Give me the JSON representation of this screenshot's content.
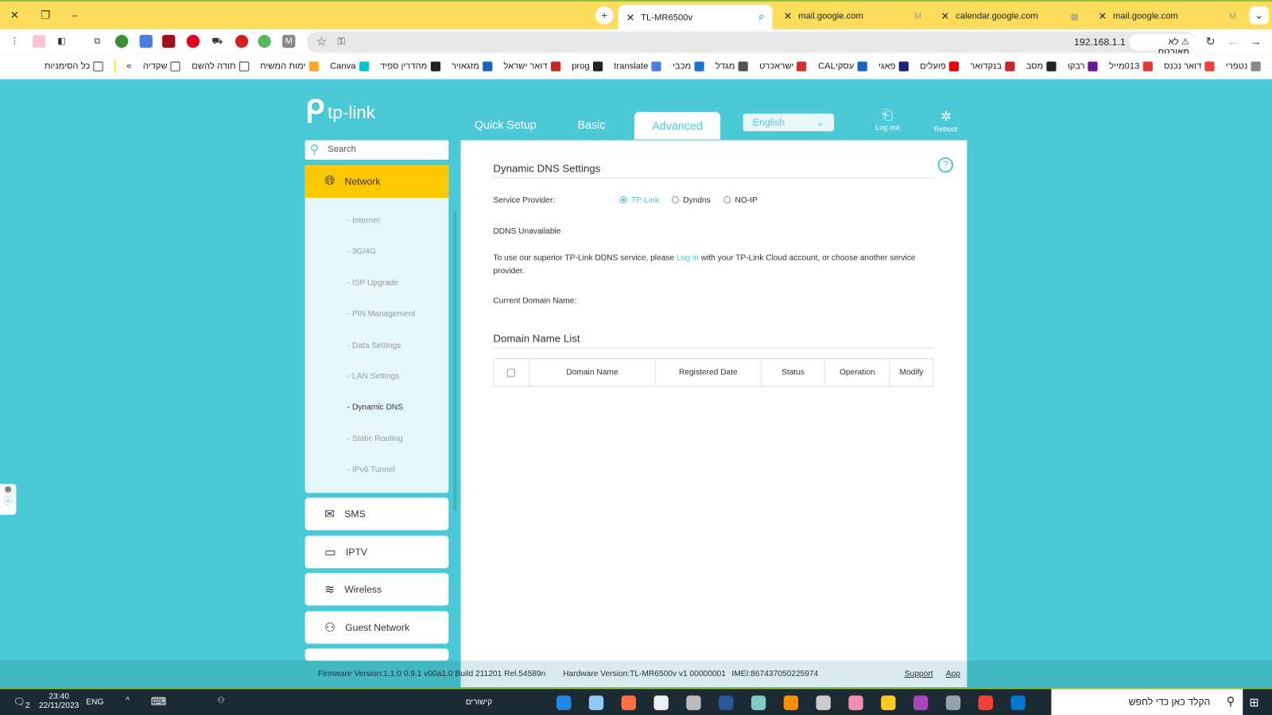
{
  "browser": {
    "tabs": [
      {
        "title": "TL-MR6500v",
        "active": true
      },
      {
        "title": "mail.google.com",
        "active": false
      },
      {
        "title": "calendar.google.com",
        "active": false
      },
      {
        "title": "mail.google.com",
        "active": false
      }
    ],
    "address": "192.168.1.1",
    "security_label": "לא מאובטח",
    "bookmarks": [
      "נטפרי",
      "דואר נכנס",
      "013מייל",
      "רבקו",
      "מסב",
      "בנקדואר",
      "פועלים",
      "פאגי",
      "עסקיCAL",
      "ישראכרט",
      "מגדל",
      "מכבי",
      "translate",
      "prog",
      "דואר ישראל",
      "מזגאויר",
      "מהדרין ספיד",
      "Canva",
      "ימות המשיח",
      "תודה להשם",
      "שקדיה"
    ],
    "bookmarks_more": "»",
    "all_bookmarks": "כל הסימניות"
  },
  "router": {
    "logo": "tp-link",
    "nav": {
      "quick_setup": "Quick Setup",
      "basic": "Basic",
      "advanced": "Advanced"
    },
    "language": "English",
    "logout": "Log out",
    "reboot": "Reboot",
    "search_placeholder": "Search",
    "sidebar": {
      "network": "Network",
      "network_items": [
        "- Internet",
        "- 3G/4G",
        "- ISP Upgrade",
        "- PIN Management",
        "- Data Settings",
        "- LAN Settings",
        "- Dynamic DNS",
        "- Static Routing",
        "- IPv6 Tunnel"
      ],
      "selected": "- Dynamic DNS",
      "menus": [
        "SMS",
        "IPTV",
        "Wireless",
        "Guest Network"
      ]
    },
    "content": {
      "title": "Dynamic DNS Settings",
      "service_provider_label": "Service Provider:",
      "providers": [
        "TP-Link",
        "Dyndns",
        "NO-IP"
      ],
      "selected_provider": "TP-Link",
      "status": "DDNS Unavailable",
      "info_before": "To use our superior TP-Link DDNS service, please ",
      "info_link": "Log in",
      "info_after": " with your TP-Link Cloud account, or choose another service provider.",
      "current_domain_label": "Current Domain Name:",
      "list_title": "Domain Name List",
      "columns": [
        "Domain Name",
        "Registered Date",
        "Status",
        "Operation",
        "Modify"
      ]
    },
    "footer": {
      "firmware": "Firmware Version:1.1.0 0.9.1 v00a1.0 Build 211201 Rel.54589n",
      "hardware": "Hardware Version:TL-MR6500v v1 00000001",
      "imei": "IMEI:867437050225974",
      "support": "Support",
      "app": "App"
    },
    "accent": "#4bc9d6",
    "highlight": "#fec703"
  },
  "taskbar": {
    "time": "23:40",
    "date": "22/11/2023",
    "lang": "ENG",
    "links": "קישורים",
    "search_placeholder": "הקלד כאן כדי לחפש",
    "notifications": "2"
  }
}
